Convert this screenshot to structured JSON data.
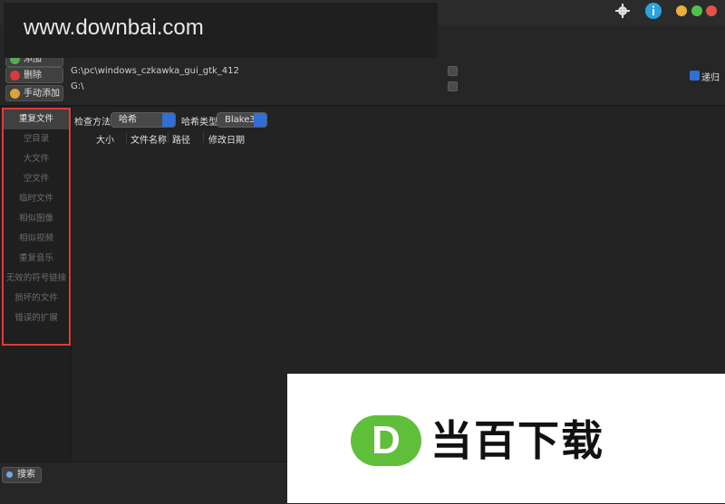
{
  "watermark": {
    "text": "www.downbai.com"
  },
  "titlebar": {
    "icons": [
      "settings-icon",
      "info-icon"
    ],
    "window_buttons": [
      "#e8b13a",
      "#4fc24a",
      "#e5514b"
    ]
  },
  "toolbar": {
    "add_label": "添加",
    "delete_label": "删除",
    "manual_add_label": "手动添加",
    "recursive_label": "递归"
  },
  "directories": [
    {
      "path": "G:\\pc\\windows_czkawka_gui_gtk_412"
    },
    {
      "path": "G:\\"
    }
  ],
  "sidebar": {
    "items": [
      {
        "label": "重复文件"
      },
      {
        "label": "空目录"
      },
      {
        "label": "大文件"
      },
      {
        "label": "空文件"
      },
      {
        "label": "临时文件"
      },
      {
        "label": "相似图像"
      },
      {
        "label": "相似视频"
      },
      {
        "label": "重复音乐"
      },
      {
        "label": "无效的符号链接"
      },
      {
        "label": "损坏的文件"
      },
      {
        "label": "错误的扩展"
      }
    ]
  },
  "main": {
    "check_method_label": "检查方法",
    "check_method_value": "哈希",
    "hash_type_label": "哈希类型",
    "hash_type_value": "Blake3",
    "columns": [
      "大小",
      "文件名称",
      "路径",
      "修改日期"
    ]
  },
  "bottom": {
    "search_label": "搜索"
  },
  "logo": {
    "letter": "D",
    "text": "当百下载"
  },
  "colors": {
    "accent": "#2f6fd6",
    "highlight_frame": "#e33a3a",
    "logo_green": "#5fbf3a"
  }
}
